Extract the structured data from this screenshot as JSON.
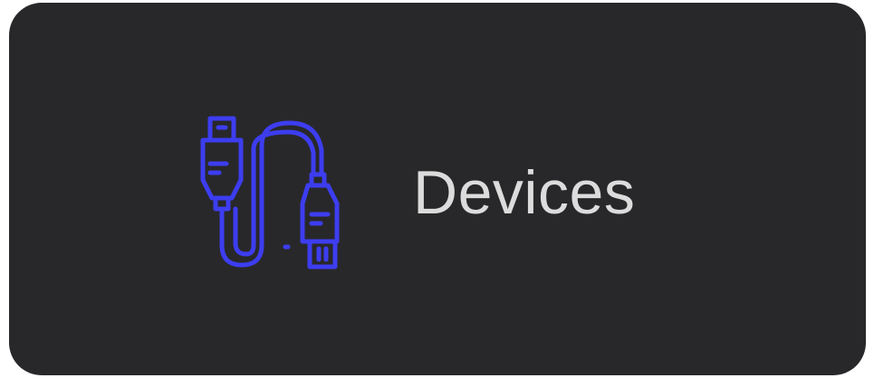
{
  "tile": {
    "label": "Devices",
    "icon": "usb-cable-icon",
    "icon_color": "#3d3df0",
    "background_color": "#28282b",
    "label_color": "#dcdcdc"
  }
}
